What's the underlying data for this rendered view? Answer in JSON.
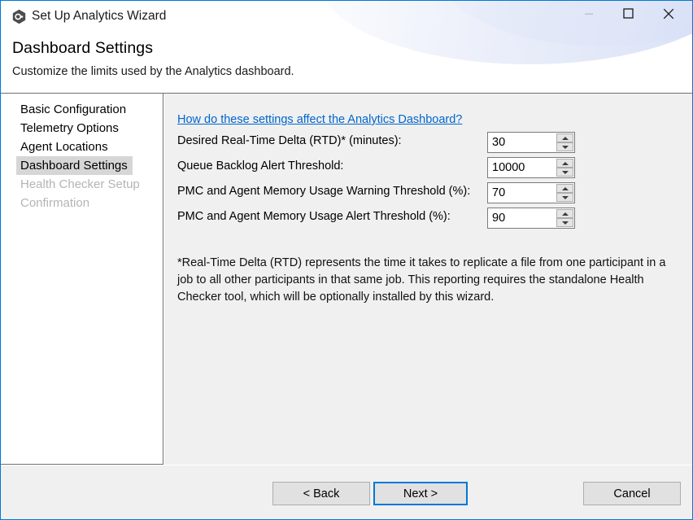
{
  "window": {
    "title": "Set Up Analytics Wizard",
    "icon": "analytics-hex-icon",
    "border_color": "#0078d7",
    "controls": {
      "minimize": "minimize-icon",
      "maximize": "maximize-icon",
      "close": "close-icon"
    }
  },
  "header": {
    "page_title": "Dashboard Settings",
    "page_subtitle": "Customize the limits used by the Analytics dashboard."
  },
  "sidebar": {
    "items": [
      {
        "label": "Basic Configuration",
        "state": "normal"
      },
      {
        "label": "Telemetry Options",
        "state": "normal"
      },
      {
        "label": "Agent Locations",
        "state": "normal"
      },
      {
        "label": "Dashboard Settings",
        "state": "selected"
      },
      {
        "label": "Health Checker Setup",
        "state": "disabled"
      },
      {
        "label": "Confirmation",
        "state": "disabled"
      }
    ],
    "selected_background": "#d6d6d6",
    "disabled_color": "#b4b4b4"
  },
  "content": {
    "help_link": "How do these settings affect the Analytics Dashboard?",
    "help_link_color": "#0066cc",
    "fields": [
      {
        "label": "Desired Real-Time Delta (RTD)* (minutes):",
        "value": "30"
      },
      {
        "label": "Queue Backlog Alert Threshold:",
        "value": "10000"
      },
      {
        "label": "PMC and Agent Memory Usage Warning Threshold (%):",
        "value": "70"
      },
      {
        "label": "PMC and Agent Memory Usage Alert Threshold (%):",
        "value": "90"
      }
    ],
    "footnote": "*Real-Time Delta (RTD) represents the time it takes to replicate a file from one participant in a job to all other participants in that same job.  This reporting requires the standalone Health Checker tool, which will be optionally installed by this wizard."
  },
  "footer": {
    "back_label": "< Back",
    "next_label": "Next >",
    "cancel_label": "Cancel",
    "focus_color": "#0078d7"
  }
}
